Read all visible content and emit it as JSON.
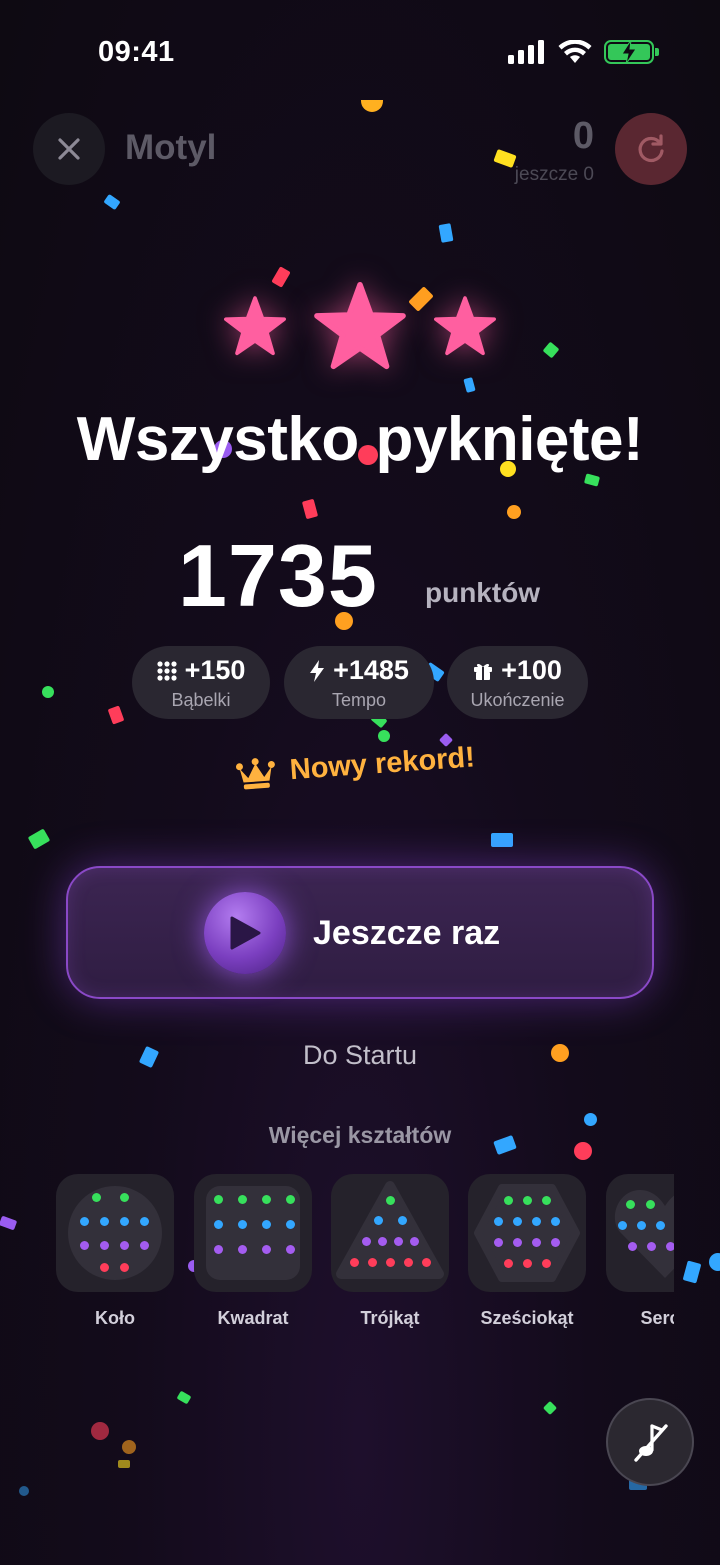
{
  "status": {
    "time": "09:41"
  },
  "header": {
    "title": "Motyl",
    "count": "0",
    "sub": "jeszcze 0"
  },
  "result": {
    "headline": "Wszystko pyknięte!",
    "score": "1735",
    "score_unit": "punktów",
    "stars_earned": 3,
    "bonuses": [
      {
        "icon": "grid-dots-icon",
        "value": "+150",
        "label": "Bąbelki"
      },
      {
        "icon": "lightning-icon",
        "value": "+1485",
        "label": "Tempo"
      },
      {
        "icon": "gift-icon",
        "value": "+100",
        "label": "Ukończenie"
      }
    ],
    "record": "Nowy rekord!"
  },
  "actions": {
    "again": "Jeszcze raz",
    "to_start": "Do Startu"
  },
  "more": {
    "title": "Więcej kształtów",
    "shapes": [
      {
        "label": "Koło"
      },
      {
        "label": "Kwadrat"
      },
      {
        "label": "Trójkąt"
      },
      {
        "label": "Sześciokąt"
      },
      {
        "label": "Serce"
      }
    ]
  },
  "colors": {
    "accent_purple": "#8a49c7",
    "star_pink": "#ff5fa0",
    "record_orange": "#ffb23f",
    "battery_green": "#34c759"
  }
}
